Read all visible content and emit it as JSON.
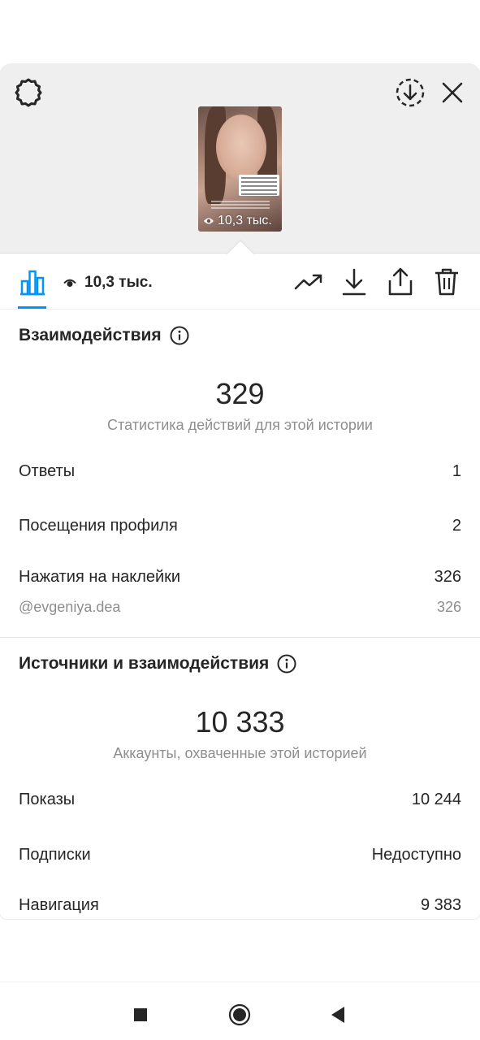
{
  "story": {
    "thumbnail_views": "10,3 тыс."
  },
  "toolbar": {
    "view_count": "10,3 тыс."
  },
  "interactions": {
    "title": "Взаимодействия",
    "total": "329",
    "subtitle": "Статистика действий для этой истории",
    "rows": [
      {
        "label": "Ответы",
        "value": "1"
      },
      {
        "label": "Посещения профиля",
        "value": "2"
      },
      {
        "label": "Нажатия на наклейки",
        "value": "326"
      }
    ],
    "sticker_detail": {
      "label": "@evgeniya.dea",
      "value": "326"
    }
  },
  "discovery": {
    "title": "Источники и взаимодействия",
    "total": "10 333",
    "subtitle": "Аккаунты, охваченные этой историей",
    "rows": [
      {
        "label": "Показы",
        "value": "10 244"
      },
      {
        "label": "Подписки",
        "value": "Недоступно"
      },
      {
        "label": "Навигация",
        "value": "9 383"
      }
    ]
  },
  "icons": {
    "settings": "settings-icon",
    "download_circle": "download-circle-icon",
    "close": "close-icon",
    "insights": "bar-chart-icon",
    "eye": "eye-icon",
    "trend": "trend-icon",
    "save": "download-icon",
    "share": "share-icon",
    "delete": "trash-icon",
    "info": "info-icon"
  },
  "colors": {
    "accent": "#0095f6",
    "text": "#262626",
    "secondary_text": "#8e8e8e",
    "header_bg": "#efefef"
  }
}
